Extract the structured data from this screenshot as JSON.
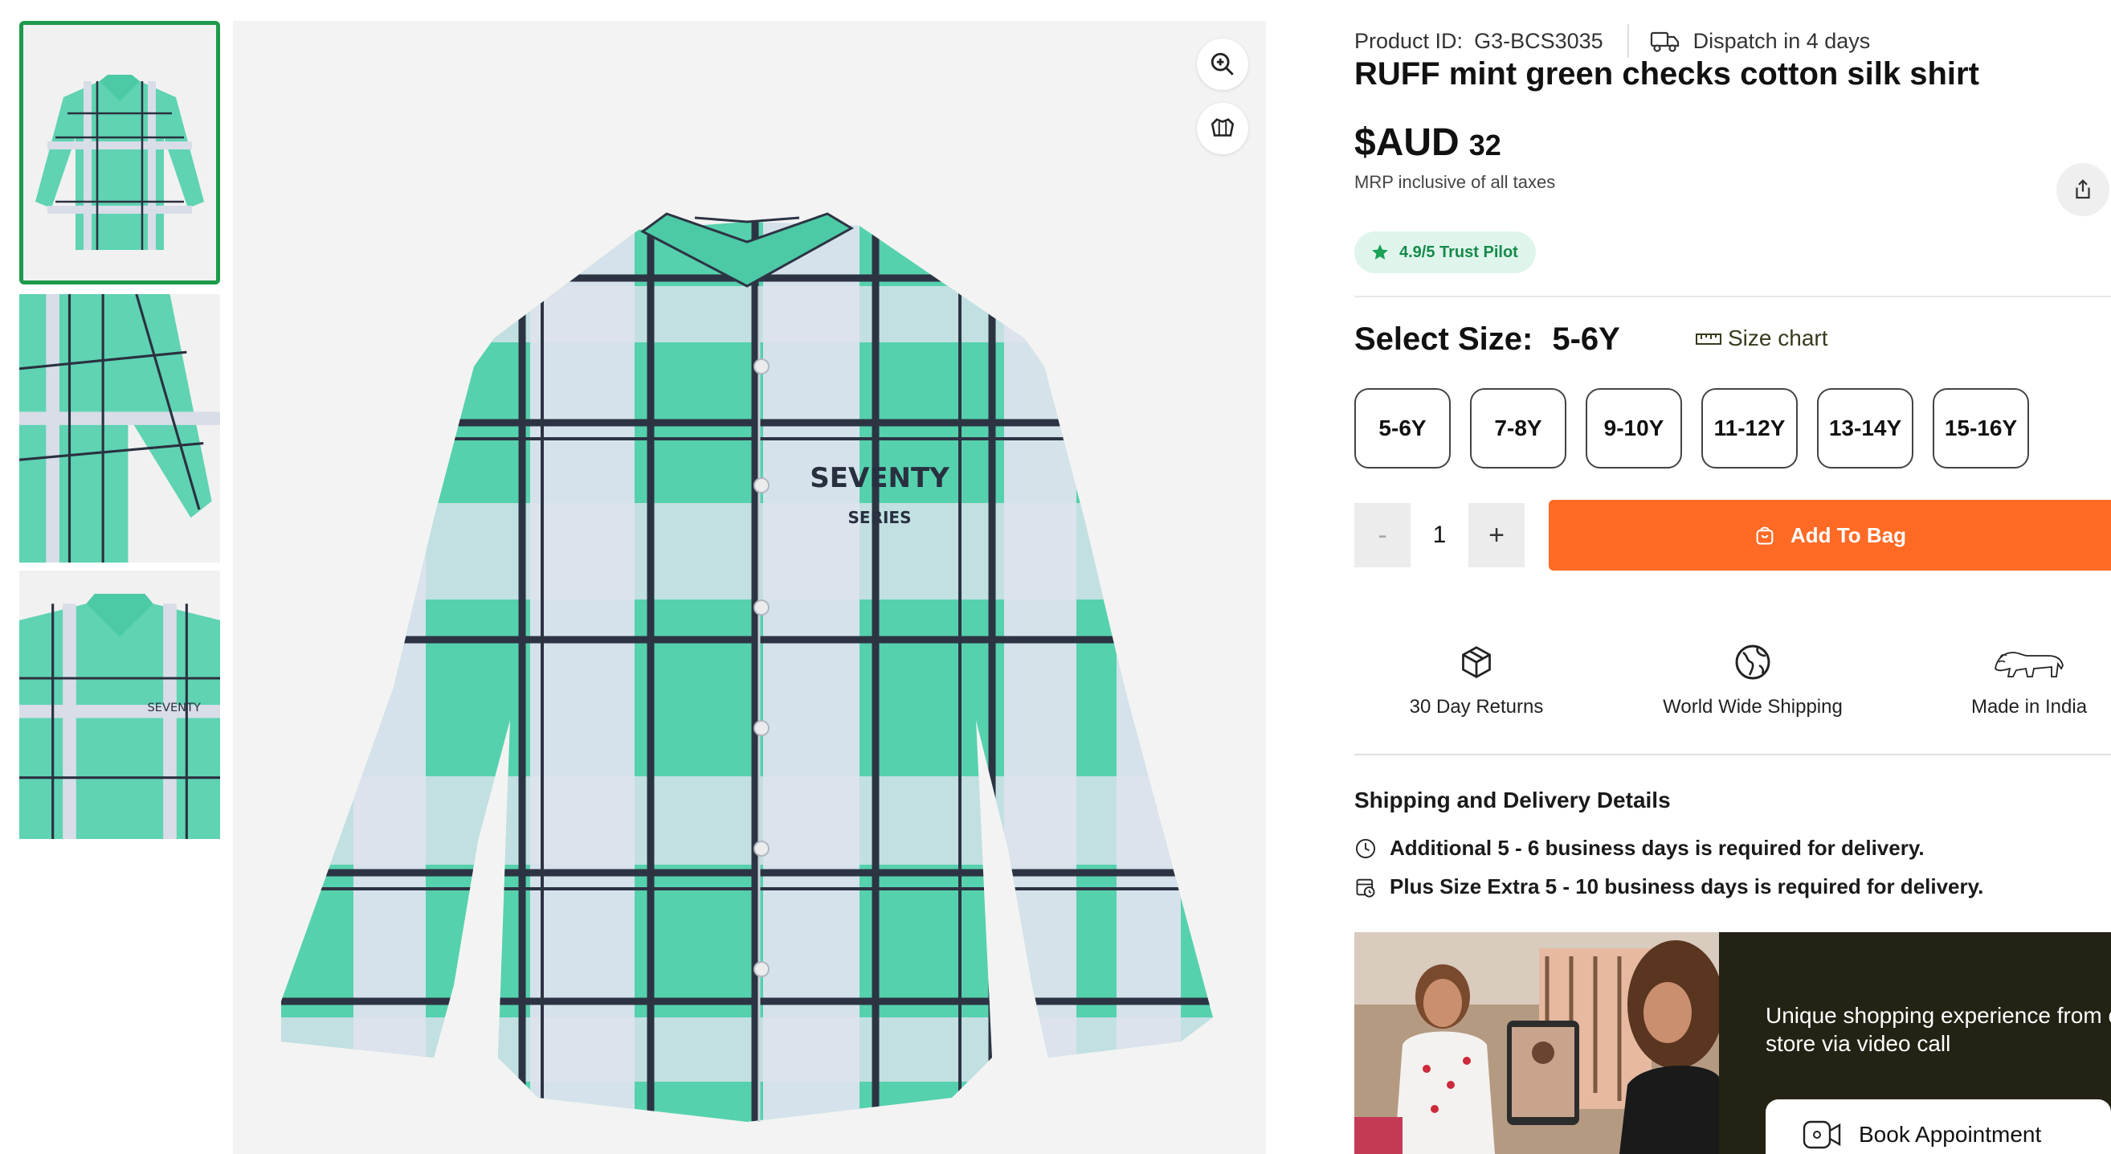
{
  "product": {
    "id_label": "Product ID:",
    "id_value": "G3-BCS3035",
    "dispatch": "Dispatch in 4 days",
    "title": "RUFF mint green checks cotton silk shirt",
    "currency": "$AUD",
    "price": "32",
    "mrp_note": "MRP inclusive of all taxes",
    "trust": "4.9/5 Trust Pilot"
  },
  "size": {
    "label": "Select Size:",
    "selected": "5-6Y",
    "chart_link": "Size chart",
    "options": [
      "5-6Y",
      "7-8Y",
      "9-10Y",
      "11-12Y",
      "13-14Y",
      "15-16Y"
    ]
  },
  "quantity": {
    "minus": "-",
    "value": "1",
    "plus": "+"
  },
  "cart": {
    "add_label": "Add To Bag"
  },
  "features": [
    {
      "label": "30 Day Returns",
      "icon": "box-icon"
    },
    {
      "label": "World Wide Shipping",
      "icon": "globe-icon"
    },
    {
      "label": "Made in India",
      "icon": "lion-icon"
    }
  ],
  "shipping": {
    "title": "Shipping and Delivery Details",
    "line1": "Additional 5 - 6 business days is required for delivery.",
    "line2": "Plus Size Extra 5 - 10 business days is required for delivery."
  },
  "banner": {
    "text_line1": "Unique shopping experience from o",
    "text_line2": "store via video call",
    "button": "Book Appointment"
  },
  "shirt_print": {
    "line1": "SEVENTY",
    "line2": "SERIES"
  },
  "colors": {
    "accent_orange": "#ff6a25",
    "selected_green": "#1e9a4b",
    "mint": "#4fd3ad",
    "trust_bg": "#dff5ec"
  }
}
